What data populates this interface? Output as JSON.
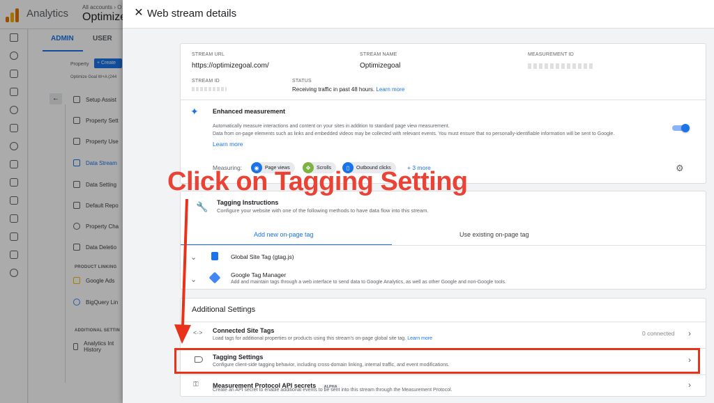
{
  "background": {
    "app_title": "Analytics",
    "breadcrumb_small": "All accounts › O",
    "account_name": "Optimize",
    "tabs": [
      "ADMIN",
      "USER"
    ],
    "property_label": "Property",
    "create_button": "+ Create",
    "property_name": "Optimize Goal W+A (244",
    "menu_items": [
      "Setup Assist",
      "Property Sett",
      "Property Use",
      "Data Stream",
      "Data Setting",
      "Default Repo",
      "Property Cha",
      "Data Deletio"
    ],
    "product_linking_header": "PRODUCT LINKING",
    "product_links": [
      "Google Ads",
      "BigQuery Lin"
    ],
    "additional_settings_header": "ADDITIONAL SETTIN",
    "additional_item": "Analytics Int History"
  },
  "drawer": {
    "title": "Web stream details",
    "stream": {
      "url_label": "STREAM URL",
      "url_value": "https://optimizegoal.com/",
      "name_label": "STREAM NAME",
      "name_value": "Optimizegoal",
      "measurement_id_label": "MEASUREMENT ID",
      "stream_id_label": "STREAM ID",
      "status_label": "STATUS",
      "status_value": "Receiving traffic in past 48 hours.",
      "status_link": "Learn more"
    },
    "enhanced": {
      "title": "Enhanced measurement",
      "desc1": "Automatically measure interactions and content on your sites in addition to standard page view measurement.",
      "desc2": "Data from on-page elements such as links and embedded videos may be collected with relevant events. You must ensure that no personally-identifiable information will be sent to Google.",
      "learn_more": "Learn more",
      "measuring_label": "Measuring:",
      "chips": [
        "Page views",
        "Scrolls",
        "Outbound clicks"
      ],
      "more": "+ 3 more"
    },
    "tagging": {
      "title": "Tagging Instructions",
      "subtitle": "Configure your website with one of the following methods to have data flow into this stream.",
      "tab_add": "Add new on-page tag",
      "tab_existing": "Use existing on-page tag",
      "gtag": "Global Site Tag (gtag.js)",
      "gtm_title": "Google Tag Manager",
      "gtm_desc": "Add and maintain tags through a web interface to send data to Google Analytics, as well as other Google and non-Google tools."
    },
    "additional": {
      "header": "Additional Settings",
      "connected_title": "Connected Site Tags",
      "connected_desc": "Load tags for additional properties or products using this stream's on-page global site tag.",
      "connected_link": "Learn more",
      "connected_count": "0 connected",
      "tagging_title": "Tagging Settings",
      "tagging_desc": "Configure client-side tagging behavior, including cross-domain linking, internal traffic, and event modifications.",
      "mp_title": "Measurement Protocol API secrets",
      "mp_badge": "ALPHA",
      "mp_desc": "Create an API secret to enable additional events to be sent into this stream through the Measurement Protocol."
    }
  },
  "annotation": {
    "text": "Click on Tagging Setting"
  },
  "colors": {
    "accent": "#1a73e8",
    "annotation": "#ea4335"
  }
}
